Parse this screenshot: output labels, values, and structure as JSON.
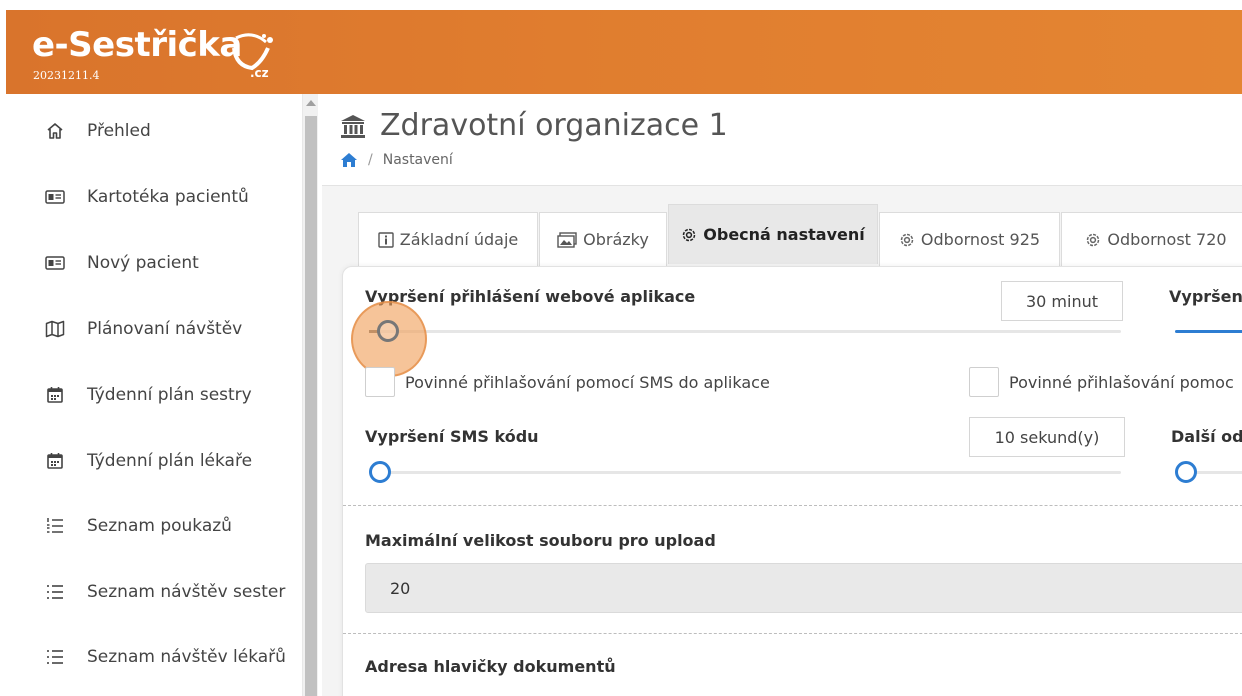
{
  "app": {
    "logo_text": "e-Sestřička",
    "version": "20231211.4",
    "domain": ".cz",
    "colors": {
      "header": "#e07d2f",
      "accent": "#2d7dd2",
      "panel_bg": "#f4f4f4"
    }
  },
  "sidebar": {
    "items": [
      {
        "label": "Přehled",
        "icon": "home-icon"
      },
      {
        "label": "Kartotéka pacientů",
        "icon": "id-card-icon"
      },
      {
        "label": "Nový pacient",
        "icon": "id-card-icon"
      },
      {
        "label": "Plánovaní návštěv",
        "icon": "map-icon"
      },
      {
        "label": "Týdenní plán sestry",
        "icon": "calendar-icon"
      },
      {
        "label": "Týdenní plán lékaře",
        "icon": "calendar-icon"
      },
      {
        "label": "Seznam poukazů",
        "icon": "list-numbered-icon"
      },
      {
        "label": "Seznam návštěv sester",
        "icon": "list-icon"
      },
      {
        "label": "Seznam návštěv lékařů",
        "icon": "list-icon"
      }
    ]
  },
  "page": {
    "title": "Zdravotní organizace 1",
    "breadcrumb_current": "Nastavení"
  },
  "tabs": [
    {
      "label": "Základní údaje",
      "icon": "info-icon",
      "active": false
    },
    {
      "label": "Obrázky",
      "icon": "images-icon",
      "active": false
    },
    {
      "label": "Obecná nastavení",
      "icon": "gear-icon",
      "active": true
    },
    {
      "label": "Odbornost 925",
      "icon": "gear-icon",
      "active": false
    },
    {
      "label": "Odbornost 720",
      "icon": "gear-icon",
      "active": false
    }
  ],
  "settings": {
    "web_timeout": {
      "label": "Vypršení přihlášení webové aplikace",
      "value": "30 minut",
      "slider_fraction": 0.0
    },
    "right_timeout": {
      "label": "Vypršení",
      "slider_fraction": 1.0
    },
    "sms_login_required": {
      "label": "Povinné přihlašování pomocí SMS do aplikace",
      "checked": false
    },
    "sms_login_required_right": {
      "label": "Povinné přihlašování pomoc",
      "checked": false
    },
    "sms_code_timeout": {
      "label": "Vypršení SMS kódu",
      "value": "10 sekund(y)",
      "slider_fraction": 0.0
    },
    "next_setting": {
      "label": "Další ode",
      "slider_fraction": 0.0
    },
    "max_upload": {
      "label": "Maximální velikost souboru pro upload",
      "value": "20"
    },
    "doc_header_address": {
      "label": "Adresa hlavičky dokumentů"
    }
  }
}
